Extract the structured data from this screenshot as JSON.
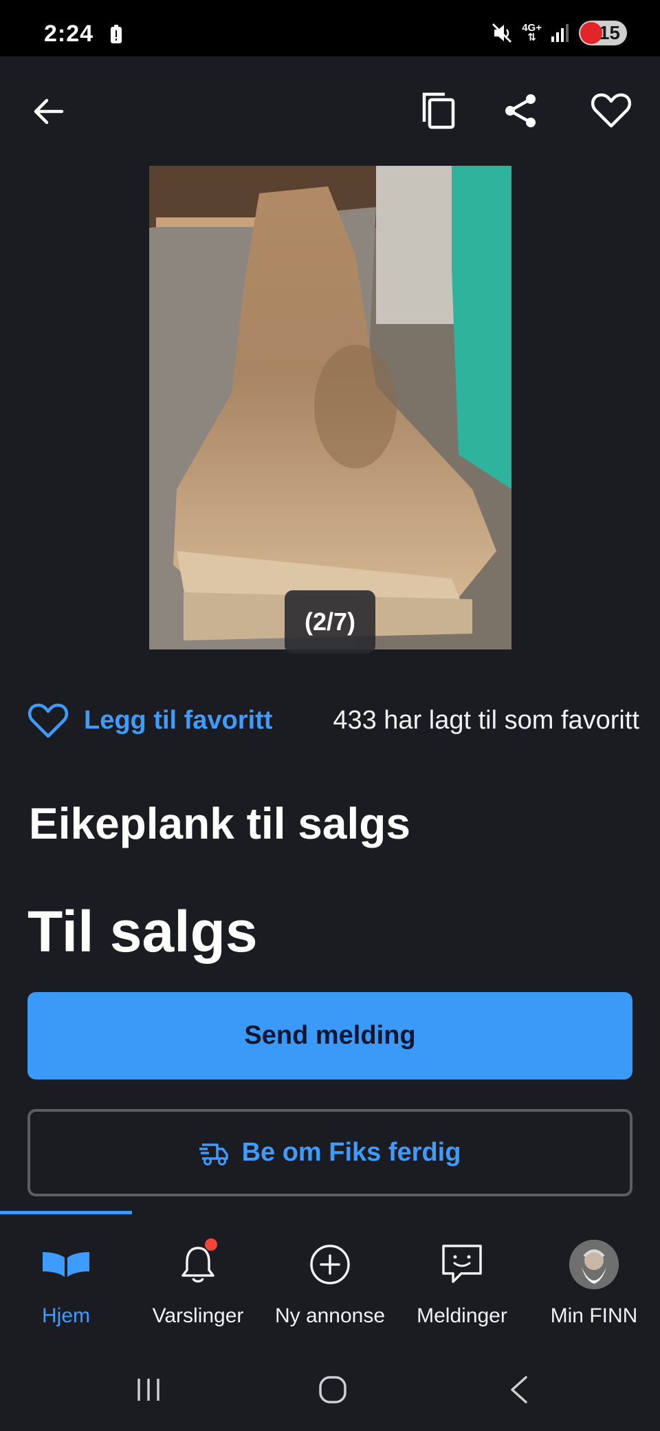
{
  "status_bar": {
    "time": "2:24",
    "network": "4G+",
    "battery": "15",
    "icons": [
      "battery-alert-icon",
      "mute-icon",
      "signal-icon"
    ]
  },
  "top_bar": {
    "icons": [
      "back-arrow-icon",
      "copy-icon",
      "share-icon",
      "heart-icon"
    ]
  },
  "gallery": {
    "counter": "(2/7)"
  },
  "favorite": {
    "add_label": "Legg til favoritt",
    "count_text": "433 har lagt til som favoritt"
  },
  "listing": {
    "title": "Eikeplank til salgs",
    "status": "Til salgs"
  },
  "actions": {
    "send_message": "Send melding",
    "fiks_ferdig": "Be om Fiks ferdig"
  },
  "bottom_nav": {
    "items": [
      {
        "label": "Hjem",
        "icon": "home-icon",
        "active": true
      },
      {
        "label": "Varslinger",
        "icon": "bell-icon",
        "active": false
      },
      {
        "label": "Ny annonse",
        "icon": "plus-circle-icon",
        "active": false
      },
      {
        "label": "Meldinger",
        "icon": "chat-icon",
        "active": false
      },
      {
        "label": "Min FINN",
        "icon": "avatar",
        "active": false
      }
    ]
  },
  "colors": {
    "background": "#1b1b22",
    "accent": "#3b99f8",
    "link": "#3f9cff",
    "notification": "#f0443d"
  }
}
